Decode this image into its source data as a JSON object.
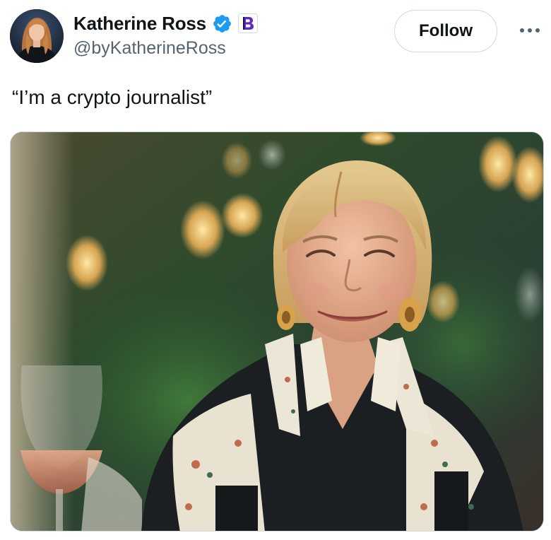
{
  "author": {
    "display_name": "Katherine Ross",
    "handle": "@byKatherineRoss",
    "verified": true,
    "affiliate_badge_icon": "b-letter-badge-icon"
  },
  "actions": {
    "follow_label": "Follow",
    "more_icon": "more-horizontal-icon"
  },
  "tweet": {
    "text": "“I’m a crypto journalist”"
  },
  "media": {
    "type": "photo",
    "alt": ""
  },
  "colors": {
    "verified_blue": "#1d9bf0",
    "badge_purple": "#5b2bc6",
    "text_primary": "#0f1419",
    "text_secondary": "#536471",
    "border": "#cfd9de"
  }
}
